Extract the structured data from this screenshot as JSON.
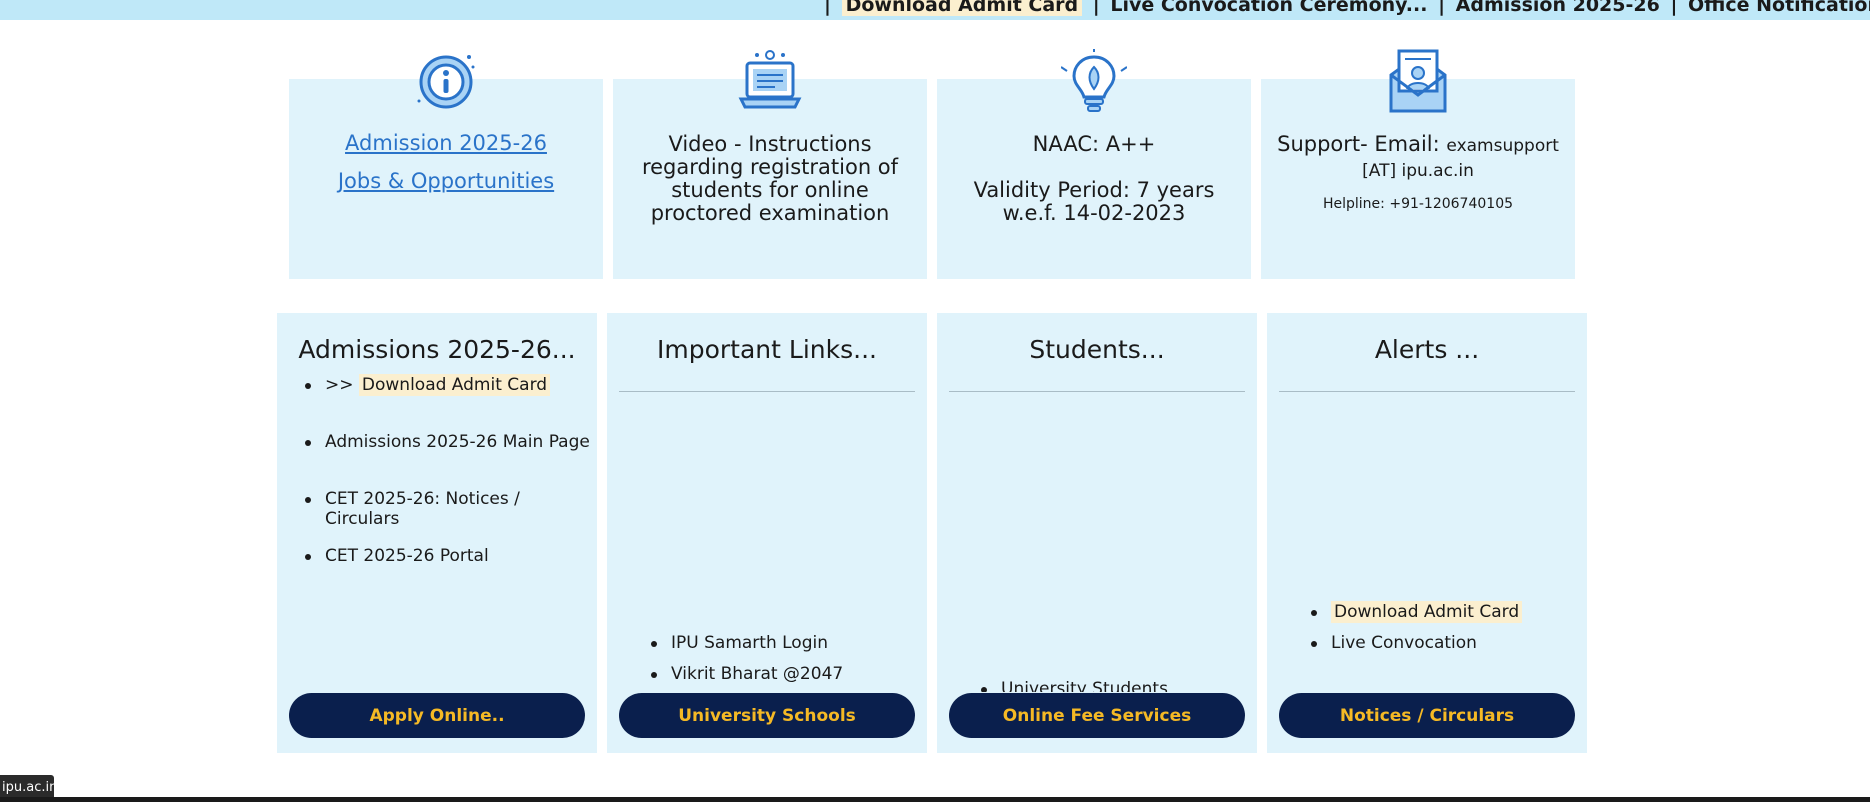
{
  "ticker": {
    "items": [
      "Download Admit Card",
      "Live Convocation Ceremony...",
      "Admission 2025-26",
      "Office Notification Regarding Examin"
    ],
    "separator": "|"
  },
  "info_cards": {
    "admission": {
      "icon": "info-icon",
      "link1": "Admission 2025-26",
      "link2": "Jobs & Opportunities"
    },
    "video": {
      "icon": "laptop-icon",
      "text": "Video - Instructions regarding registration of students for online proctored examination"
    },
    "naac": {
      "icon": "lightbulb-icon",
      "line1": "NAAC: A++",
      "line2": "Validity Period: 7 years w.e.f. 14-02-2023"
    },
    "support": {
      "icon": "email-icon",
      "label": "Support- Email:",
      "email": "examsupport [AT] ipu.ac.in",
      "helpline": "Helpline: +91-1206740105"
    }
  },
  "panels": {
    "admissions": {
      "title": "Admissions 2025-26...",
      "prefix": ">>",
      "items": [
        "Download Admit Card",
        "Admissions 2025-26 Main Page",
        "CET 2025-26: Notices / Circulars",
        "CET 2025-26 Portal"
      ],
      "button": "Apply Online.."
    },
    "links": {
      "title": "Important Links...",
      "items": [
        "IPU Samarth Login",
        "Vikrit Bharat @2047"
      ],
      "button": "University Schools"
    },
    "students": {
      "title": "Students...",
      "items": [
        "University Students"
      ],
      "button": "Online Fee Services"
    },
    "alerts": {
      "title": "Alerts ...",
      "items": [
        "Download Admit Card",
        "Live Convocation"
      ],
      "button": "Notices / Circulars"
    }
  },
  "status_bar": {
    "text": "ipu.ac.in"
  },
  "colors": {
    "ticker_bg": "#bfe8f8",
    "card_bg": "#e0f3fb",
    "button_bg": "#0a1f4d",
    "button_text": "#f5b925",
    "link": "#2a73c9",
    "highlight": "#fbefcf"
  }
}
